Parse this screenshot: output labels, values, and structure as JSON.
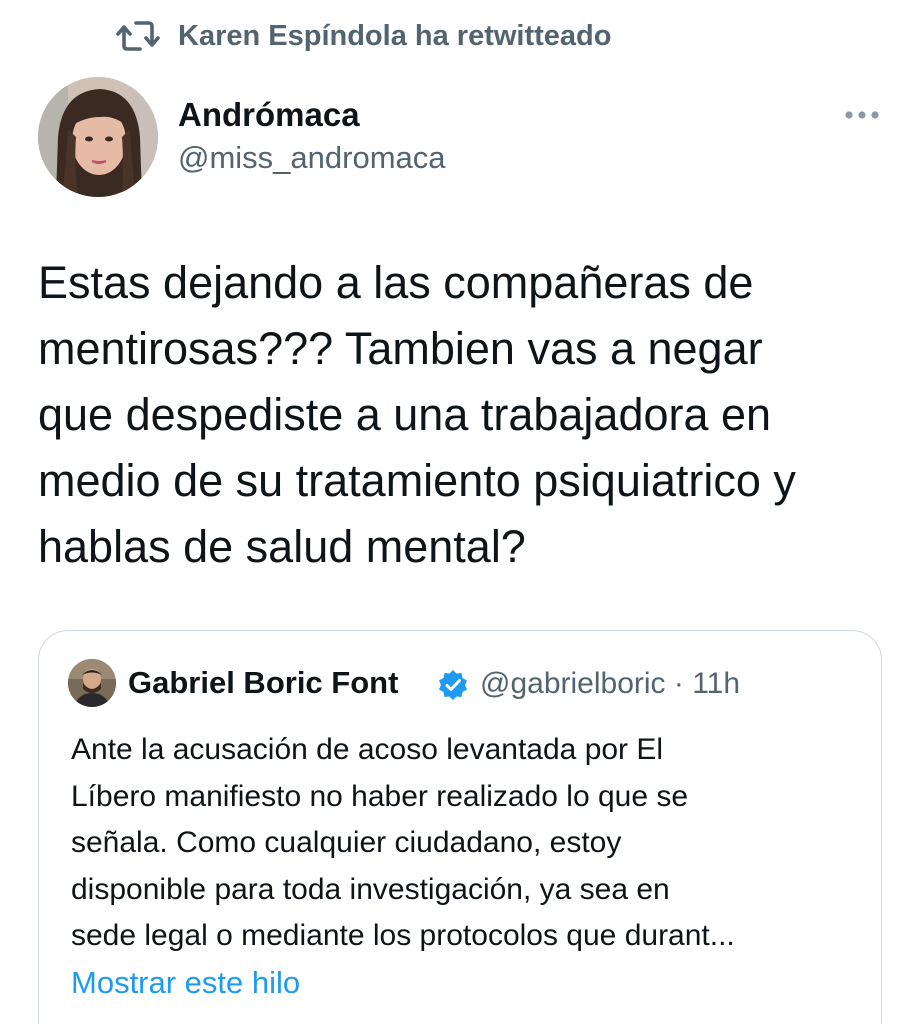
{
  "retweet": {
    "icon": "retweet-icon",
    "label": "Karen Espíndola ha retwitteado"
  },
  "tweet": {
    "author_name": "Andrómaca",
    "author_handle": "@miss_andromaca",
    "more_icon": "more-dots-icon",
    "text_lines": [
      "Estas dejando a las compañeras de",
      "mentirosas??? Tambien vas a negar",
      "que despediste a una trabajadora en",
      "medio de su tratamiento psiquiatrico y",
      "hablas de salud mental?"
    ]
  },
  "quoted_tweet": {
    "author_name": "Gabriel Boric Font",
    "verified_icon": "verified-badge-icon",
    "handle_time": "@gabrielboric · 11h",
    "text_lines": [
      "Ante la acusación de acoso levantada por El",
      "Líbero manifiesto no haber realizado lo que se",
      "señala. Como cualquier ciudadano, estoy",
      "disponible para toda investigación, ya sea en",
      "sede legal o mediante los protocolos que durant..."
    ],
    "show_thread_label": "Mostrar este hilo"
  },
  "colors": {
    "text_primary": "#0f1419",
    "text_secondary": "#536471",
    "link": "#1d9bf0",
    "border": "#cfd9de",
    "verified": "#1d9bf0"
  }
}
